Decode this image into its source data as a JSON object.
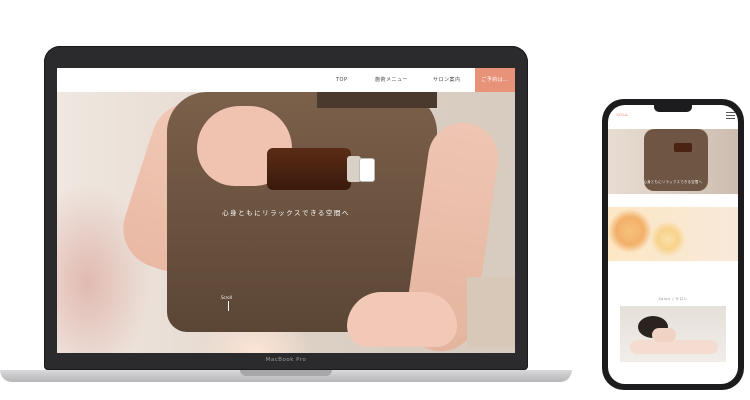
{
  "laptop": {
    "model_label": "MacBook Pro",
    "nav": {
      "top": "TOP",
      "menu": "施術メニュー",
      "salon": "サロン案内",
      "contact": "ご予約は…"
    },
    "hero": {
      "tagline": "心身ともにリラックスできる空間へ",
      "scroll_label": "Scroll"
    }
  },
  "phone": {
    "logo": "SOLA",
    "hero_tagline": "心身ともにリラックスできる空間へ",
    "section_title": "Salon / サロン"
  },
  "colors": {
    "accent": "#e8927a",
    "apron": "#6f5644",
    "device_frame": "#2b2b2d"
  }
}
